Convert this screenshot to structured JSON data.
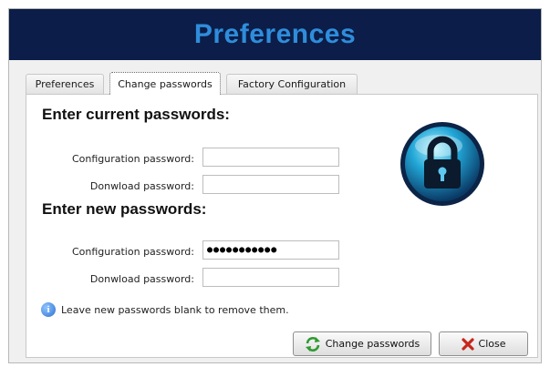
{
  "window": {
    "title": "Preferences"
  },
  "tabs": [
    {
      "label": "Preferences"
    },
    {
      "label": "Change passwords"
    },
    {
      "label": "Factory Configuration"
    }
  ],
  "current_section": {
    "heading": "Enter current passwords:",
    "config_label": "Configuration password:",
    "config_value": "",
    "download_label": "Donwload password:",
    "download_value": ""
  },
  "new_section": {
    "heading": "Enter new passwords:",
    "config_label": "Configuration password:",
    "config_value": "●●●●●●●●●●●",
    "download_label": "Donwload password:",
    "download_value": ""
  },
  "info": {
    "text": "Leave new passwords blank to remove them.",
    "icon": "info-icon"
  },
  "buttons": {
    "change_label": "Change passwords",
    "change_icon": "refresh-icon",
    "close_label": "Close",
    "close_icon": "x-icon"
  },
  "icons": {
    "lock": "padlock-icon"
  },
  "colors": {
    "titlebar_bg": "#0b1d48",
    "title_text": "#2f8ddb",
    "close_x": "#c8261b",
    "refresh": "#2f9a2f"
  }
}
